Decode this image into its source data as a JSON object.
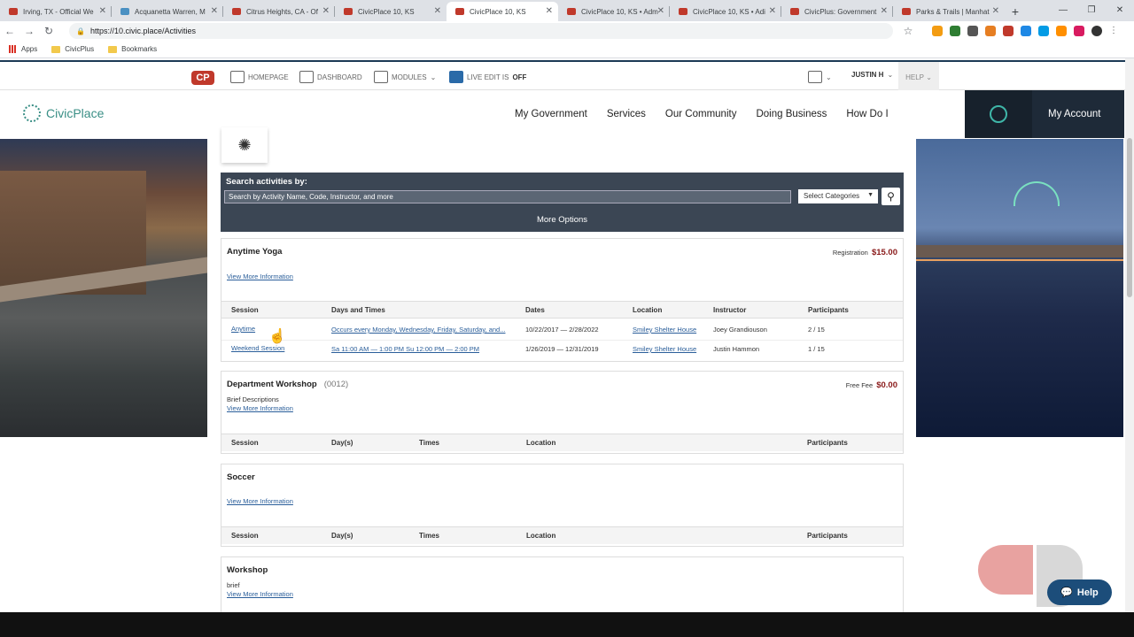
{
  "browser": {
    "tabs": [
      {
        "title": "Irving, TX - Official We"
      },
      {
        "title": "Acquanetta Warren, M"
      },
      {
        "title": "Citrus Heights, CA - Of"
      },
      {
        "title": "CivicPlace 10, KS"
      },
      {
        "title": "CivicPlace 10, KS",
        "active": true
      },
      {
        "title": "CivicPlace 10, KS • Adm"
      },
      {
        "title": "CivicPlace 10, KS • Adi"
      },
      {
        "title": "CivicPlus: Government"
      },
      {
        "title": "Parks & Trails | Manhat"
      }
    ],
    "url": "https://10.civic.place/Activities",
    "bookmarks": [
      "Apps",
      "CivicPlus",
      "Bookmarks"
    ]
  },
  "admin": {
    "homepage": "HOMEPAGE",
    "dashboard": "DASHBOARD",
    "modules": "MODULES",
    "live_edit": "LIVE EDIT IS",
    "live_edit_state": "OFF",
    "user": "JUSTIN H",
    "help": "HELP"
  },
  "site": {
    "logo_text": "CivicPlace",
    "nav": [
      "My Government",
      "Services",
      "Our Community",
      "Doing Business",
      "How Do I"
    ],
    "account": "My Account"
  },
  "search": {
    "label": "Search activities by:",
    "placeholder": "Search by Activity Name, Code, Instructor, and more",
    "categories": "Select Categories",
    "more_options": "More Options"
  },
  "activities": [
    {
      "title": "Anytime Yoga",
      "code": "",
      "fee_label": "Registration",
      "fee": "$15.00",
      "link": "View More Information",
      "headers": [
        "Session",
        "Days and Times",
        "Dates",
        "Location",
        "Instructor",
        "Participants"
      ],
      "rows": [
        [
          "Anytime",
          "Occurs every Monday, Wednesday, Friday, Saturday, and...",
          "10/22/2017 — 2/28/2022",
          "Smiley Shelter House",
          "Joey Grandiouson",
          "2 / 15"
        ],
        [
          "Weekend Session",
          "Sa 11:00 AM — 1:00 PM Su 12:00 PM — 2:00 PM",
          "1/26/2019 — 12/31/2019",
          "Smiley Shelter House",
          "Justin Hammon",
          "1 / 15"
        ]
      ]
    },
    {
      "title": "Department Workshop",
      "code": "(0012)",
      "fee_label": "Free Fee",
      "fee": "$0.00",
      "desc": "Brief Descriptions",
      "link": "View More Information",
      "headers": [
        "Session",
        "Day(s)",
        "Times",
        "Location",
        "Participants"
      ]
    },
    {
      "title": "Soccer",
      "link": "View More Information",
      "headers": [
        "Session",
        "Day(s)",
        "Times",
        "Location",
        "Participants"
      ]
    },
    {
      "title": "Workshop",
      "desc": "brief",
      "link": "View More Information"
    }
  ],
  "help_button": "Help"
}
